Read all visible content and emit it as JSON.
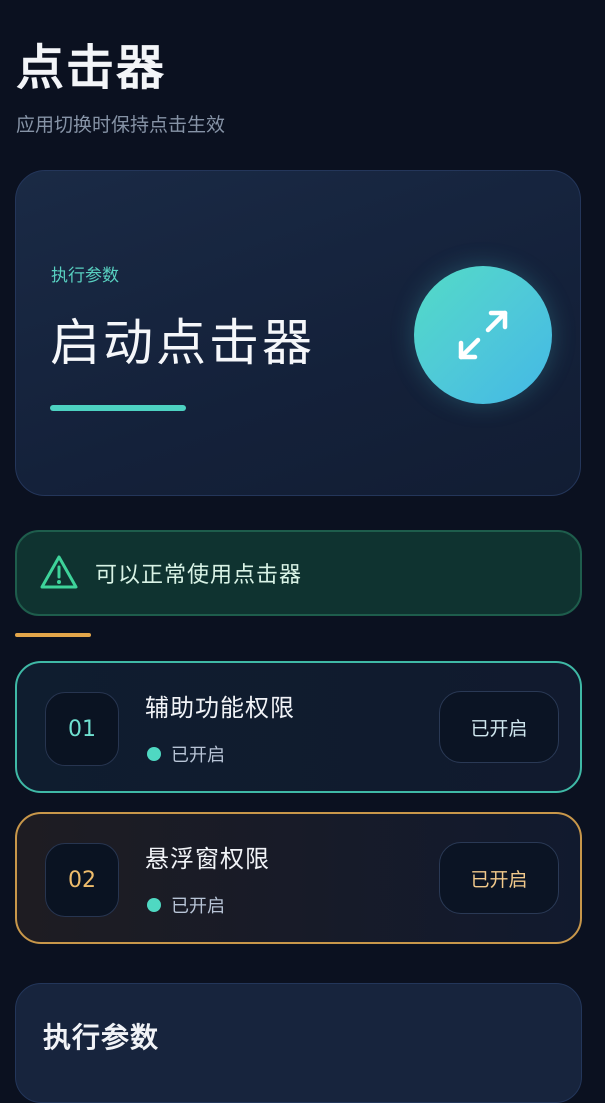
{
  "header": {
    "title": "点击器",
    "subtitle": "应用切换时保持点击生效"
  },
  "hero": {
    "label": "执行参数",
    "title": "启动点击器",
    "icon": "expand-arrows-icon",
    "accent": "#4dd2c2"
  },
  "alert": {
    "icon": "warning-triangle-icon",
    "text": "可以正常使用点击器",
    "color": "#3ed39a"
  },
  "permissions": [
    {
      "number": "01",
      "title": "辅助功能权限",
      "status": "已开启",
      "button": "已开启",
      "accent": "#3fb9a6"
    },
    {
      "number": "02",
      "title": "悬浮窗权限",
      "status": "已开启",
      "button": "已开启",
      "accent": "#c8974a"
    }
  ],
  "params": {
    "title": "执行参数"
  }
}
